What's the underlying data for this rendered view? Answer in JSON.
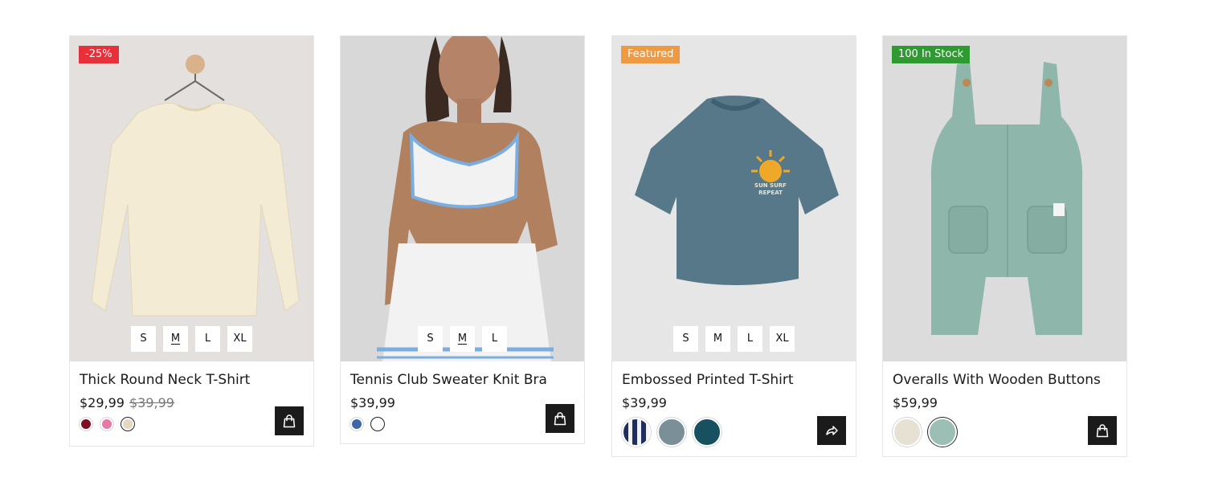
{
  "products": [
    {
      "title": "Thick Round Neck T-Shirt",
      "price": "$29,99",
      "old_price": "$39,99",
      "badge": "-25%",
      "badge_color": "#e8303a",
      "sizes": [
        "S",
        "M",
        "L",
        "XL"
      ],
      "selected_size": "M",
      "swatches": [
        "#7e0f22",
        "#e57aa8",
        "#e5d7c3"
      ],
      "selected_swatch": 2,
      "action_icon": "shopping-bag-icon"
    },
    {
      "title": "Tennis Club Sweater Knit Bra",
      "price": "$39,99",
      "sizes": [
        "S",
        "M",
        "L"
      ],
      "selected_size": "M",
      "swatches": [
        "#3f66a6",
        "#ffffff"
      ],
      "selected_swatch": 1,
      "action_icon": "shopping-bag-icon"
    },
    {
      "title": "Embossed Printed T-Shirt",
      "price": "$39,99",
      "badge": "Featured",
      "badge_color": "#ee9a43",
      "sizes": [
        "S",
        "M",
        "L",
        "XL"
      ],
      "swatches": [
        "navy-stripe",
        "#7b8f98",
        "#17505e"
      ],
      "action_icon": "share-arrow-icon"
    },
    {
      "title": "Overalls With Wooden Buttons",
      "price": "$59,99",
      "badge": "100 In Stock",
      "badge_color": "#2f9a32",
      "swatches": [
        "#e7e1d4",
        "#9bbfb5"
      ],
      "selected_swatch": 1,
      "action_icon": "shopping-bag-icon"
    }
  ]
}
